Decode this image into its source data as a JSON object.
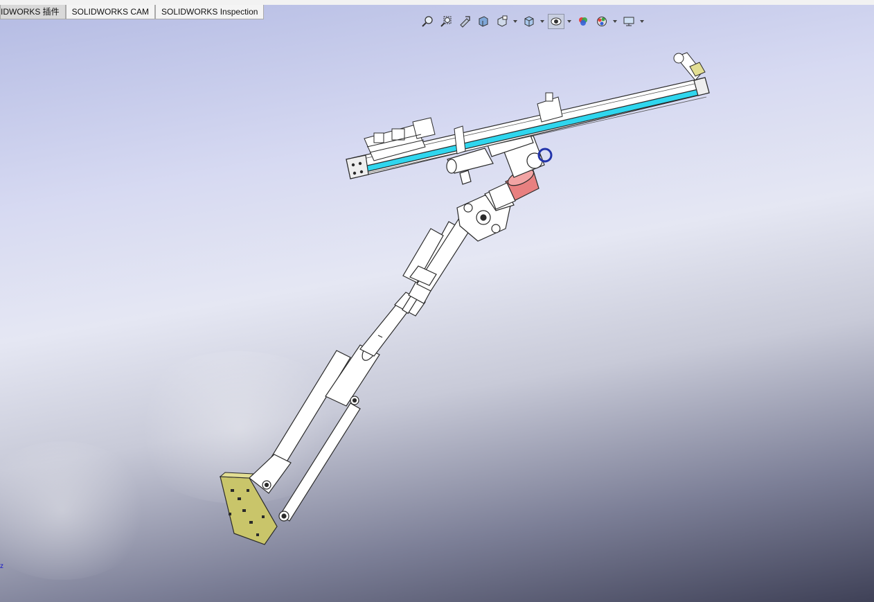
{
  "tabs": [
    {
      "label": "IDWORKS 插件",
      "active": true
    },
    {
      "label": "SOLIDWORKS CAM",
      "active": false
    },
    {
      "label": "SOLIDWORKS Inspection",
      "active": false
    }
  ],
  "heads_up_toolbar": [
    {
      "icon": "zoom-to-fit-icon"
    },
    {
      "icon": "zoom-to-area-icon"
    },
    {
      "icon": "previous-view-icon"
    },
    {
      "icon": "section-view-icon"
    },
    {
      "icon": "dynamic-annotation-view-icon"
    },
    {
      "icon": "view-orientation-icon"
    },
    {
      "icon": "display-style-icon"
    },
    {
      "icon": "hide-show-items-icon"
    },
    {
      "icon": "edit-appearance-icon"
    },
    {
      "icon": "apply-scene-icon"
    },
    {
      "icon": "view-settings-icon"
    }
  ],
  "triad_label": "z",
  "colors": {
    "rail_stripe": "#2fd6ee",
    "coupling_red": "#e88080",
    "base_plate": "#c9c56a",
    "ring_blue": "#2233aa",
    "active_tab": "#d9d9d9"
  }
}
